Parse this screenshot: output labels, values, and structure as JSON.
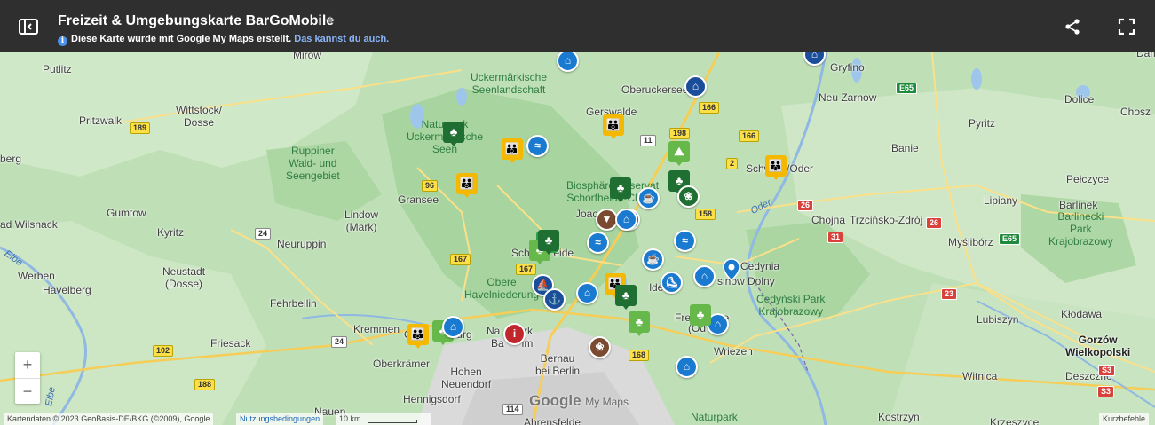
{
  "header": {
    "title": "Freizeit & Umgebungskarte BarGoMobile",
    "subtitle_prefix": "Diese Karte wurde mit Google My Maps erstellt.",
    "subtitle_link": "Das kannst du auch."
  },
  "icons": {
    "panel": "sidebar-toggle-icon",
    "star": "star-icon",
    "share": "share-icon",
    "fullscreen": "fullscreen-icon",
    "info": "info-icon"
  },
  "colors": {
    "header_bg": "#2f2f2f",
    "forest_marker": "#2e9e46",
    "marker_blue": "#1a7ad0",
    "marker_yellow": "#f4b800",
    "marker_brown": "#7a4b30",
    "marker_red": "#c0272d"
  },
  "map": {
    "places": {
      "putlitz": "Putlitz",
      "mirow": "Mirow",
      "gryfino": "Gryfino",
      "neu_zarnow": "Neu Zarnow",
      "dolice": "Dolice",
      "pyritz": "Pyritz",
      "chosz": "Chosz",
      "pritzwalk": "Pritzwalk",
      "wittstock": "Wittstock/\nDosse",
      "oberuckersee": "Oberuckersee",
      "gerswalde": "Gerswalde",
      "banie": "Banie",
      "berg": "berg",
      "gransee": "Gransee",
      "schwedt": "Schwedt/Oder",
      "pelczyce": "Pełczyce",
      "lipiany": "Lipiany",
      "gumtow": "Gumtow",
      "lindow": "Lindow\n(Mark)",
      "joachimsthal": "Joac",
      "chojna": "Chojna",
      "trzcinsko": "Trzcińsko-Zdrój",
      "barlinek": "Barlinek",
      "bad_wilsnack": "ad Wilsnack",
      "kyritz": "Kyritz",
      "neuruppin": "Neuruppin",
      "mysliborz": "Myślibórz",
      "werben": "Werben",
      "neustadt": "Neustadt\n(Dosse)",
      "schorfheide": "Sch        eide",
      "cedynia": "Cedynia",
      "havelberg": "Havelberg",
      "eberswalde": "E          lde",
      "osinow": "sinów Dolny",
      "fehrbellin": "Fehrbellin",
      "lubiszyn": "Lubiszyn",
      "klodawa": "Kłodawa",
      "kremmen": "Kremmen",
      "oranienburg": "O             burg",
      "bernau_label": "Na        rk",
      "freienwalde": "Fre           e",
      "oder_town": "(Od",
      "friesack": "Friesack",
      "wriezen": "Wriezen",
      "gorzow": "Gorzów\nWielkopolski",
      "oberkraemer": "Oberkrämer",
      "hohen_neuendorf": "Hohen\nNeuendorf",
      "bernau": "Bernau\nbei Berlin",
      "barnim": "Ba      im",
      "witnica": "Witnica",
      "deszczno": "Deszczno",
      "hennigsdorf": "Hennigsdorf",
      "nauen": "Nauen",
      "kostrzyn": "Kostrzyn",
      "krzeszyce": "Krzeszyce",
      "ahrensfelde": "Ahrensfelde",
      "dam": "Dam"
    },
    "areas": {
      "uckermark_lakes": "Uckermärkische\nSeenlandschaft",
      "np_uckermark": "Naturpark\nUckermärkische\nSeen",
      "ruppiner": "Ruppiner\nWald- und\nSeengebiet",
      "biosphaere": "Biosphärenreservat\nSchorfheide-Chorin",
      "obere_havel": "Obere\nHavelniederung",
      "cedynski": "Cedyński Park\nKrajobrazowy",
      "barlinecki": "Barlinecki\nPark\nKrajobrazowy",
      "naturpark_bottom": "Naturpark"
    },
    "water": {
      "oder": "Oder",
      "elbe_1": "Elbe",
      "elbe_2": "Elbe"
    },
    "roads": [
      "189",
      "166",
      "198",
      "2",
      "11",
      "96",
      "24",
      "167",
      "158",
      "26",
      "31",
      "E65",
      "E65",
      "26",
      "167",
      "102",
      "24",
      "188",
      "114",
      "168",
      "23",
      "S3",
      "S3",
      "166"
    ],
    "markers": [
      {
        "kind": "museum",
        "icon": "museum-icon"
      },
      {
        "kind": "museum",
        "icon": "museum-icon"
      },
      {
        "kind": "forest",
        "icon": "trees-icon"
      },
      {
        "kind": "family",
        "icon": "family-icon"
      },
      {
        "kind": "swim",
        "icon": "swimming-icon"
      },
      {
        "kind": "family",
        "icon": "family-icon"
      },
      {
        "kind": "family",
        "icon": "family-icon"
      },
      {
        "kind": "park",
        "icon": "park-icon"
      },
      {
        "kind": "forest",
        "icon": "trees-icon"
      },
      {
        "kind": "museum",
        "icon": "museum-icon"
      },
      {
        "kind": "zoo",
        "icon": "paw-icon"
      },
      {
        "kind": "family",
        "icon": "family-icon"
      },
      {
        "kind": "forest",
        "icon": "trees-icon"
      },
      {
        "kind": "cafe",
        "icon": "cup-icon"
      },
      {
        "kind": "monument",
        "icon": "monument-icon"
      },
      {
        "kind": "swim",
        "icon": "swimming-icon"
      },
      {
        "kind": "swim",
        "icon": "swimming-icon"
      },
      {
        "kind": "forest",
        "icon": "trees-icon"
      },
      {
        "kind": "boat",
        "icon": "boat-icon"
      },
      {
        "kind": "cafe",
        "icon": "cup-icon"
      },
      {
        "kind": "museum",
        "icon": "museum-icon"
      },
      {
        "kind": "pin",
        "icon": "location-pin-icon"
      },
      {
        "kind": "sport",
        "icon": "sport-icon"
      },
      {
        "kind": "museum",
        "icon": "museum-icon"
      },
      {
        "kind": "forest",
        "icon": "trees-icon"
      },
      {
        "kind": "family",
        "icon": "family-icon"
      },
      {
        "kind": "forest",
        "icon": "trees-icon"
      },
      {
        "kind": "ship",
        "icon": "ship-icon"
      },
      {
        "kind": "museum",
        "icon": "museum-icon"
      },
      {
        "kind": "forest",
        "icon": "trees-icon"
      },
      {
        "kind": "museum",
        "icon": "museum-icon"
      },
      {
        "kind": "family",
        "icon": "family-icon"
      },
      {
        "kind": "forest",
        "icon": "trees-icon"
      },
      {
        "kind": "museum",
        "icon": "museum-icon"
      },
      {
        "kind": "info",
        "icon": "info-icon"
      },
      {
        "kind": "zoo",
        "icon": "paw-icon"
      },
      {
        "kind": "forest",
        "icon": "trees-icon"
      },
      {
        "kind": "museum",
        "icon": "museum-icon"
      },
      {
        "kind": "forest",
        "icon": "trees-icon"
      },
      {
        "kind": "museum",
        "icon": "museum-icon"
      }
    ]
  },
  "zoom": {
    "in_label": "+",
    "out_label": "−"
  },
  "google_logo": {
    "text": "Google",
    "suffix": "My Maps"
  },
  "footer": {
    "attribution": "Kartendaten © 2023 GeoBasis-DE/BKG (©2009), Google",
    "terms": "Nutzungsbedingungen",
    "scale": "10 km",
    "shortcuts": "Kurzbefehle"
  }
}
